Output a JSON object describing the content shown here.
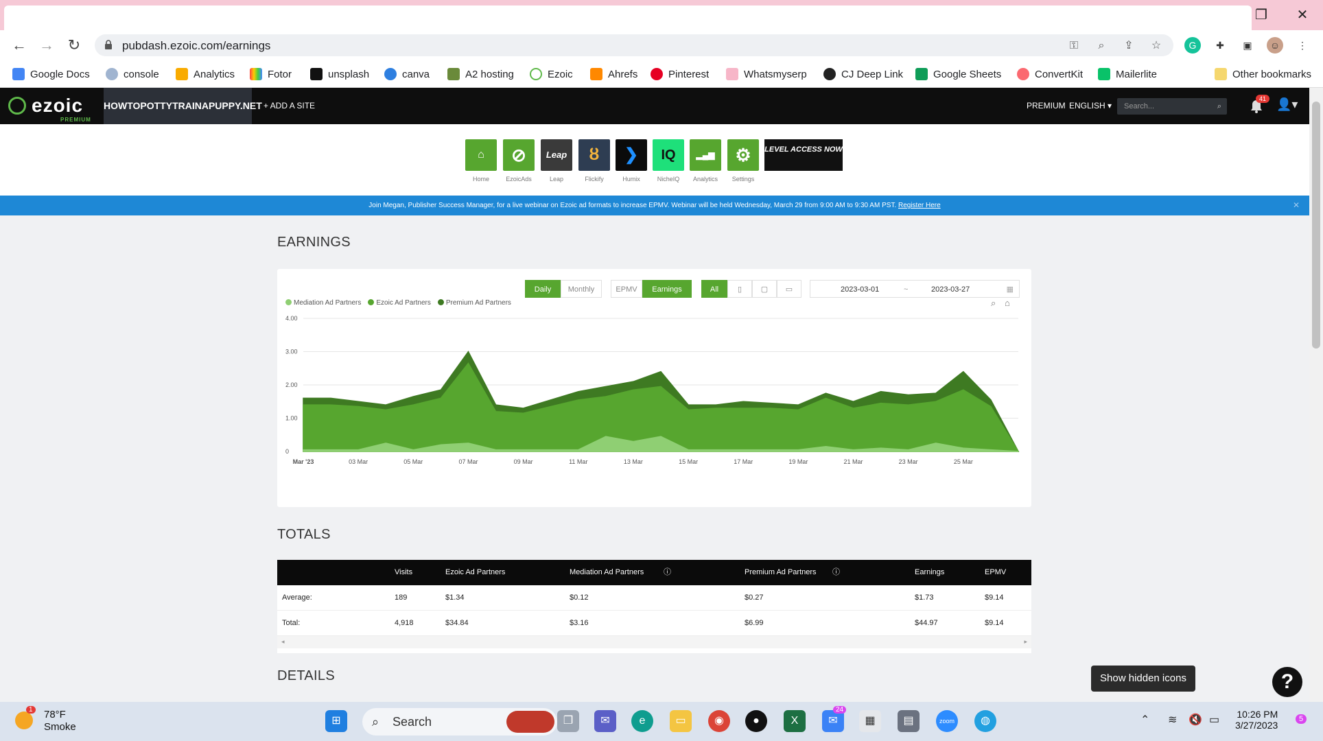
{
  "browser": {
    "url": "pubdash.ezoic.com/earnings",
    "bookmarks": [
      "Google Docs",
      "console",
      "Analytics",
      "Fotor",
      "unsplash",
      "canva",
      "A2 hosting",
      "Ezoic",
      "Ahrefs",
      "Pinterest",
      "Whatsmyserp",
      "CJ Deep Link",
      "Google Sheets",
      "ConvertKit",
      "Mailerlite"
    ],
    "other_bookmarks": "Other bookmarks"
  },
  "header": {
    "logo": "ezoic",
    "logo_sub": "PREMIUM",
    "site": "HOWTOPOTTYTRAINAPUPPY.NET",
    "add_site": "+ ADD A SITE",
    "premium": "PREMIUM",
    "language": "ENGLISH",
    "search_placeholder": "Search...",
    "notifications": "41"
  },
  "apps": [
    {
      "label": "Home",
      "color": "#57a62f",
      "glyph": "⌂"
    },
    {
      "label": "EzoicAds",
      "color": "#57a62f",
      "glyph": "⊘"
    },
    {
      "label": "Leap",
      "color": "#3a3a3a",
      "glyph": "Leap"
    },
    {
      "label": "Flickify",
      "color": "#2e3d52",
      "glyph": "ȣ"
    },
    {
      "label": "Humix",
      "color": "#0b0b0b",
      "glyph": "❯"
    },
    {
      "label": "NicheIQ",
      "color": "#1ee07a",
      "glyph": "IQ"
    },
    {
      "label": "Analytics",
      "color": "#57a62f",
      "glyph": "▂▄▆"
    },
    {
      "label": "Settings",
      "color": "#57a62f",
      "glyph": "⚙"
    }
  ],
  "level_button": "LEVEL ACCESS NOW",
  "banner": {
    "text": "Join Megan, Publisher Success Manager, for a live webinar on Ezoic ad formats to increase EPMV. Webinar will be held Wednesday, March 29 from 9:00 AM to 9:30 AM PST.",
    "link": "Register Here",
    "close": "✕"
  },
  "earnings": {
    "title": "EARNINGS",
    "toggles": {
      "daily": "Daily",
      "monthly": "Monthly",
      "epmv": "EPMV",
      "earnings": "Earnings",
      "all": "All"
    },
    "date_from": "2023-03-01",
    "date_sep": "~",
    "date_to": "2023-03-27"
  },
  "chart_data": {
    "type": "area",
    "legend": [
      "Mediation Ad Partners",
      "Ezoic Ad Partners",
      "Premium Ad Partners"
    ],
    "y_ticks": [
      "4.00",
      "3.00",
      "2.00",
      "1.00",
      "0"
    ],
    "ylim": [
      0,
      4
    ],
    "x_tick_labels": [
      "Mar '23",
      "03 Mar",
      "05 Mar",
      "07 Mar",
      "09 Mar",
      "11 Mar",
      "13 Mar",
      "15 Mar",
      "17 Mar",
      "19 Mar",
      "21 Mar",
      "23 Mar",
      "25 Mar"
    ],
    "x": [
      "2023-03-01",
      "2023-03-02",
      "2023-03-03",
      "2023-03-04",
      "2023-03-05",
      "2023-03-06",
      "2023-03-07",
      "2023-03-08",
      "2023-03-09",
      "2023-03-10",
      "2023-03-11",
      "2023-03-12",
      "2023-03-13",
      "2023-03-14",
      "2023-03-15",
      "2023-03-16",
      "2023-03-17",
      "2023-03-18",
      "2023-03-19",
      "2023-03-20",
      "2023-03-21",
      "2023-03-22",
      "2023-03-23",
      "2023-03-24",
      "2023-03-25",
      "2023-03-26",
      "2023-03-27"
    ],
    "series": [
      {
        "name": "Mediation Ad Partners",
        "color": "#8fcf73",
        "values": [
          0.05,
          0.05,
          0.05,
          0.25,
          0.05,
          0.2,
          0.25,
          0.05,
          0.05,
          0.05,
          0.05,
          0.45,
          0.3,
          0.45,
          0.05,
          0.05,
          0.05,
          0.05,
          0.05,
          0.15,
          0.05,
          0.1,
          0.05,
          0.25,
          0.1,
          0.05,
          0.0
        ]
      },
      {
        "name": "Ezoic Ad Partners",
        "color": "#57a62f",
        "values": [
          1.35,
          1.35,
          1.3,
          1.0,
          1.35,
          1.4,
          2.4,
          1.15,
          1.1,
          1.3,
          1.5,
          1.2,
          1.55,
          1.5,
          1.2,
          1.25,
          1.25,
          1.25,
          1.2,
          1.45,
          1.25,
          1.35,
          1.35,
          1.25,
          1.75,
          1.3,
          0.0
        ]
      },
      {
        "name": "Premium Ad Partners",
        "color": "#3e7a22",
        "values": [
          0.2,
          0.2,
          0.15,
          0.15,
          0.25,
          0.25,
          0.35,
          0.2,
          0.15,
          0.2,
          0.25,
          0.3,
          0.25,
          0.45,
          0.15,
          0.1,
          0.2,
          0.15,
          0.15,
          0.15,
          0.2,
          0.35,
          0.3,
          0.25,
          0.55,
          0.2,
          0.0
        ]
      }
    ]
  },
  "totals": {
    "title": "TOTALS",
    "columns": [
      "Visits",
      "Ezoic Ad Partners",
      "Mediation Ad Partners",
      "Premium Ad Partners",
      "Earnings",
      "EPMV"
    ],
    "rows": [
      {
        "label": "Average:",
        "values": [
          "189",
          "$1.34",
          "$0.12",
          "$0.27",
          "$1.73",
          "$9.14"
        ]
      },
      {
        "label": "Total:",
        "values": [
          "4,918",
          "$34.84",
          "$3.16",
          "$6.99",
          "$44.97",
          "$9.14"
        ]
      }
    ]
  },
  "details_title": "DETAILS",
  "tooltip": "Show hidden icons",
  "help": "?",
  "taskbar": {
    "weather_temp": "78°F",
    "weather_desc": "Smoke",
    "weather_badge": "1",
    "search": "Search",
    "mail_badge": "24",
    "time": "10:26 PM",
    "date": "3/27/2023",
    "notif_badge": "5"
  }
}
